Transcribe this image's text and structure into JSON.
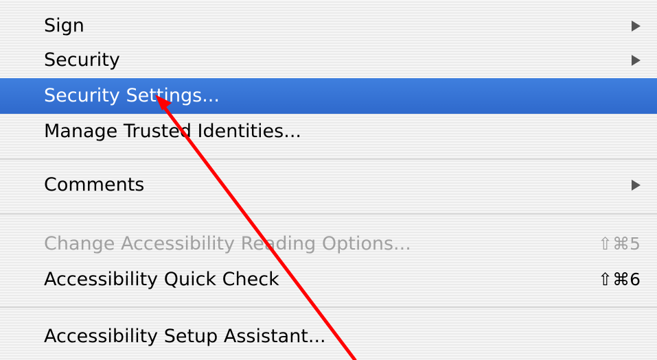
{
  "menu": {
    "items": [
      {
        "label": "Sign",
        "submenu_icon": "submenu-arrow-icon"
      },
      {
        "label": "Security",
        "submenu_icon": "submenu-arrow-icon"
      },
      {
        "label": "Security Settings...",
        "state": "highlighted"
      },
      {
        "label": "Manage Trusted Identities..."
      },
      {
        "label": "Comments",
        "submenu_icon": "submenu-arrow-icon"
      },
      {
        "label": "Change Accessibility Reading Options...",
        "shortcut": "⇧⌘5",
        "state": "disabled"
      },
      {
        "label": "Accessibility Quick Check",
        "shortcut": "⇧⌘6"
      },
      {
        "label": "Accessibility Setup Assistant..."
      }
    ]
  },
  "colors": {
    "highlight": "#2f6bd0",
    "annotation_arrow": "#ff0000",
    "disabled_text": "#a0a0a0"
  }
}
